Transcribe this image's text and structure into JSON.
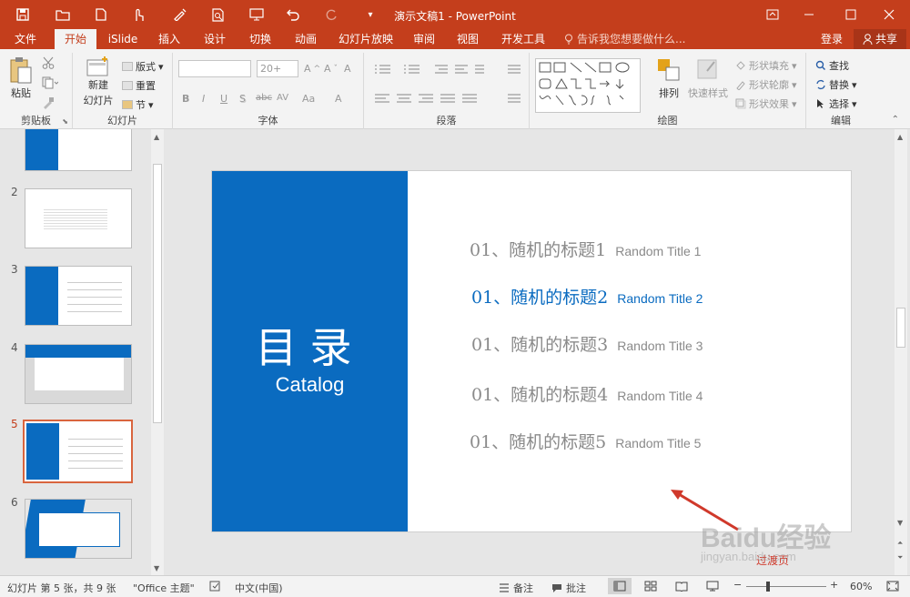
{
  "window": {
    "title": "演示文稿1 - PowerPoint",
    "quick_access": [
      "save-icon",
      "open-icon",
      "new-icon",
      "touch-icon",
      "format-painter-icon",
      "print-preview-icon",
      "slideshow-icon",
      "undo-icon",
      "redo-icon",
      "customize-icon"
    ]
  },
  "menu": {
    "items": [
      "文件",
      "开始",
      "iSlide",
      "插入",
      "设计",
      "切换",
      "动画",
      "幻灯片放映",
      "审阅",
      "视图",
      "开发工具"
    ],
    "active": "开始",
    "tellme": "告诉我您想要做什么...",
    "login": "登录",
    "share": "共享"
  },
  "ribbon": {
    "clipboard": {
      "label": "剪贴板",
      "paste": "粘贴"
    },
    "slides": {
      "label": "幻灯片",
      "new_slide": "新建",
      "new_slide2": "幻灯片",
      "layout": "版式",
      "reset": "重置",
      "section": "节"
    },
    "font": {
      "label": "字体",
      "font_name": "",
      "font_size": "20+",
      "bold": "B",
      "italic": "I",
      "underline": "U",
      "shadow": "S",
      "strike": "abc",
      "spacing": "AV",
      "case": "Aa",
      "color": "A"
    },
    "paragraph": {
      "label": "段落"
    },
    "drawing": {
      "label": "绘图",
      "arrange": "排列",
      "quick_styles": "快速样式",
      "shape_fill": "形状填充",
      "shape_outline": "形状轮廓",
      "shape_effect": "形状效果"
    },
    "editing": {
      "label": "编辑",
      "find": "查找",
      "replace": "替换",
      "select": "选择"
    }
  },
  "slides_panel": {
    "numbers": [
      "2",
      "3",
      "4",
      "5",
      "6"
    ],
    "selected": "5"
  },
  "slide": {
    "heading": "目录",
    "subheading": "Catalog",
    "items": [
      {
        "zh": "01、随机的标题1",
        "en": "Random Title 1",
        "highlight": false
      },
      {
        "zh": "01、随机的标题2",
        "en": "Random Title 2",
        "highlight": true
      },
      {
        "zh": "01、随机的标题3",
        "en": "Random Title 3",
        "highlight": false
      },
      {
        "zh": "01、随机的标题4",
        "en": "Random Title 4",
        "highlight": false
      },
      {
        "zh": "01、随机的标题5",
        "en": "Random Title 5",
        "highlight": false
      }
    ],
    "accent_color": "#0a6bc0",
    "annotation": "过渡页",
    "annotation_color": "#d0392b"
  },
  "status": {
    "slide_info": "幻灯片 第 5 张，共 9 张",
    "theme": "\"Office 主题\"",
    "language": "中文(中国)",
    "notes": "备注",
    "comments": "批注",
    "zoom": "60%"
  },
  "watermark": {
    "brand": "Baidu经验",
    "url": "jingyan.baidu.com"
  }
}
